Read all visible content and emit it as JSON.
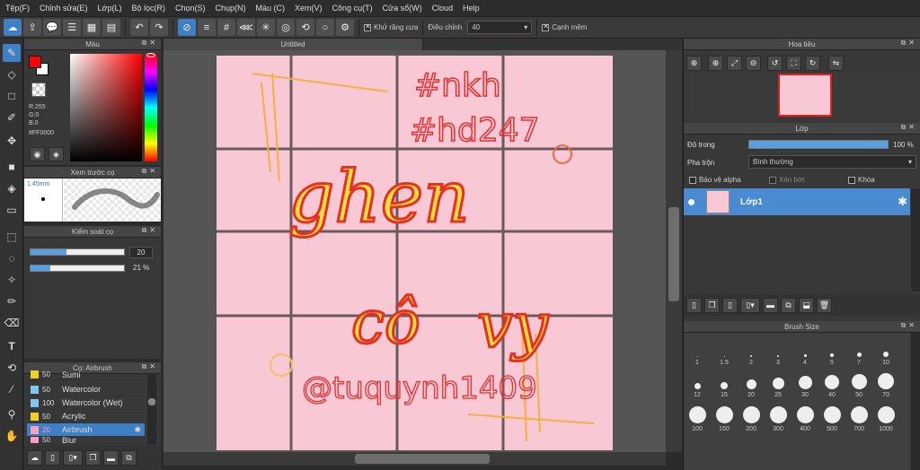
{
  "menu": [
    "Tệp(F)",
    "Chỉnh sửa(E)",
    "Lớp(L)",
    "Bộ lọc(R)",
    "Chọn(S)",
    "Chụp(N)",
    "Màu (C)",
    "Xem(V)",
    "Công cụ(T)",
    "Cửa sổ(W)",
    "Cloud",
    "Help"
  ],
  "toolbar": {
    "antialias_label": "Khử răng cưa",
    "adjust_label": "Điều chỉnh",
    "adjust_value": "40",
    "smooth_edge_label": "Cạnh mềm"
  },
  "color_panel": {
    "title": "Màu",
    "r": "R:255",
    "g": "G:0",
    "b": "B:0",
    "hex": "#FF0000",
    "primary": "#ff0000",
    "secondary": "#ffffff"
  },
  "brush_preview": {
    "title": "Xem trước cọ",
    "size": "1.45mm"
  },
  "brush_control": {
    "title": "Kiểm soát cọ",
    "size_value": "20",
    "opacity_value": "21 %",
    "size_fraction": 0.38,
    "opacity_fraction": 0.21
  },
  "brush_list": {
    "title": "Cọ: Airbrush",
    "items": [
      {
        "size": "50",
        "name": "Sumi",
        "color": "#f0d020"
      },
      {
        "size": "50",
        "name": "Watercolor",
        "color": "#80c8f0"
      },
      {
        "size": "100",
        "name": "Watercolor (Wet)",
        "color": "#80c8f0"
      },
      {
        "size": "50",
        "name": "Acrylic",
        "color": "#f0d020"
      },
      {
        "size": "20",
        "name": "Airbrush",
        "color": "#f8a0c0"
      },
      {
        "size": "50",
        "name": "Blur",
        "color": "#f8a0c0"
      }
    ]
  },
  "document": {
    "tab": "Untitled"
  },
  "artwork": {
    "tag1": "#nkh",
    "tag2": "#hd247",
    "word1": "ghen",
    "word2": "cô",
    "word3": "vy",
    "signature": "@tuquynh1409"
  },
  "navigator": {
    "title": "Hoa tiêu"
  },
  "layer_panel": {
    "title": "Lớp",
    "opacity_label": "Độ trong",
    "opacity_value": "100 %",
    "opacity_fraction": 1.0,
    "blend_label": "Pha trộn",
    "blend_value": "Bình thường",
    "protect_alpha": "Bảo vệ alpha",
    "clipping": "Xén bớt",
    "lock": "Khóa",
    "layer_name": "Lớp1"
  },
  "brush_size": {
    "title": "Brush Size",
    "sizes": [
      "1",
      "1.5",
      "2",
      "3",
      "4",
      "5",
      "7",
      "10",
      "12",
      "15",
      "20",
      "25",
      "30",
      "40",
      "50",
      "70",
      "100",
      "150",
      "200",
      "300",
      "400",
      "500",
      "700",
      "1000"
    ]
  },
  "colors": {
    "accent": "#3f7fc4",
    "canvas": "#f8c8d4"
  }
}
